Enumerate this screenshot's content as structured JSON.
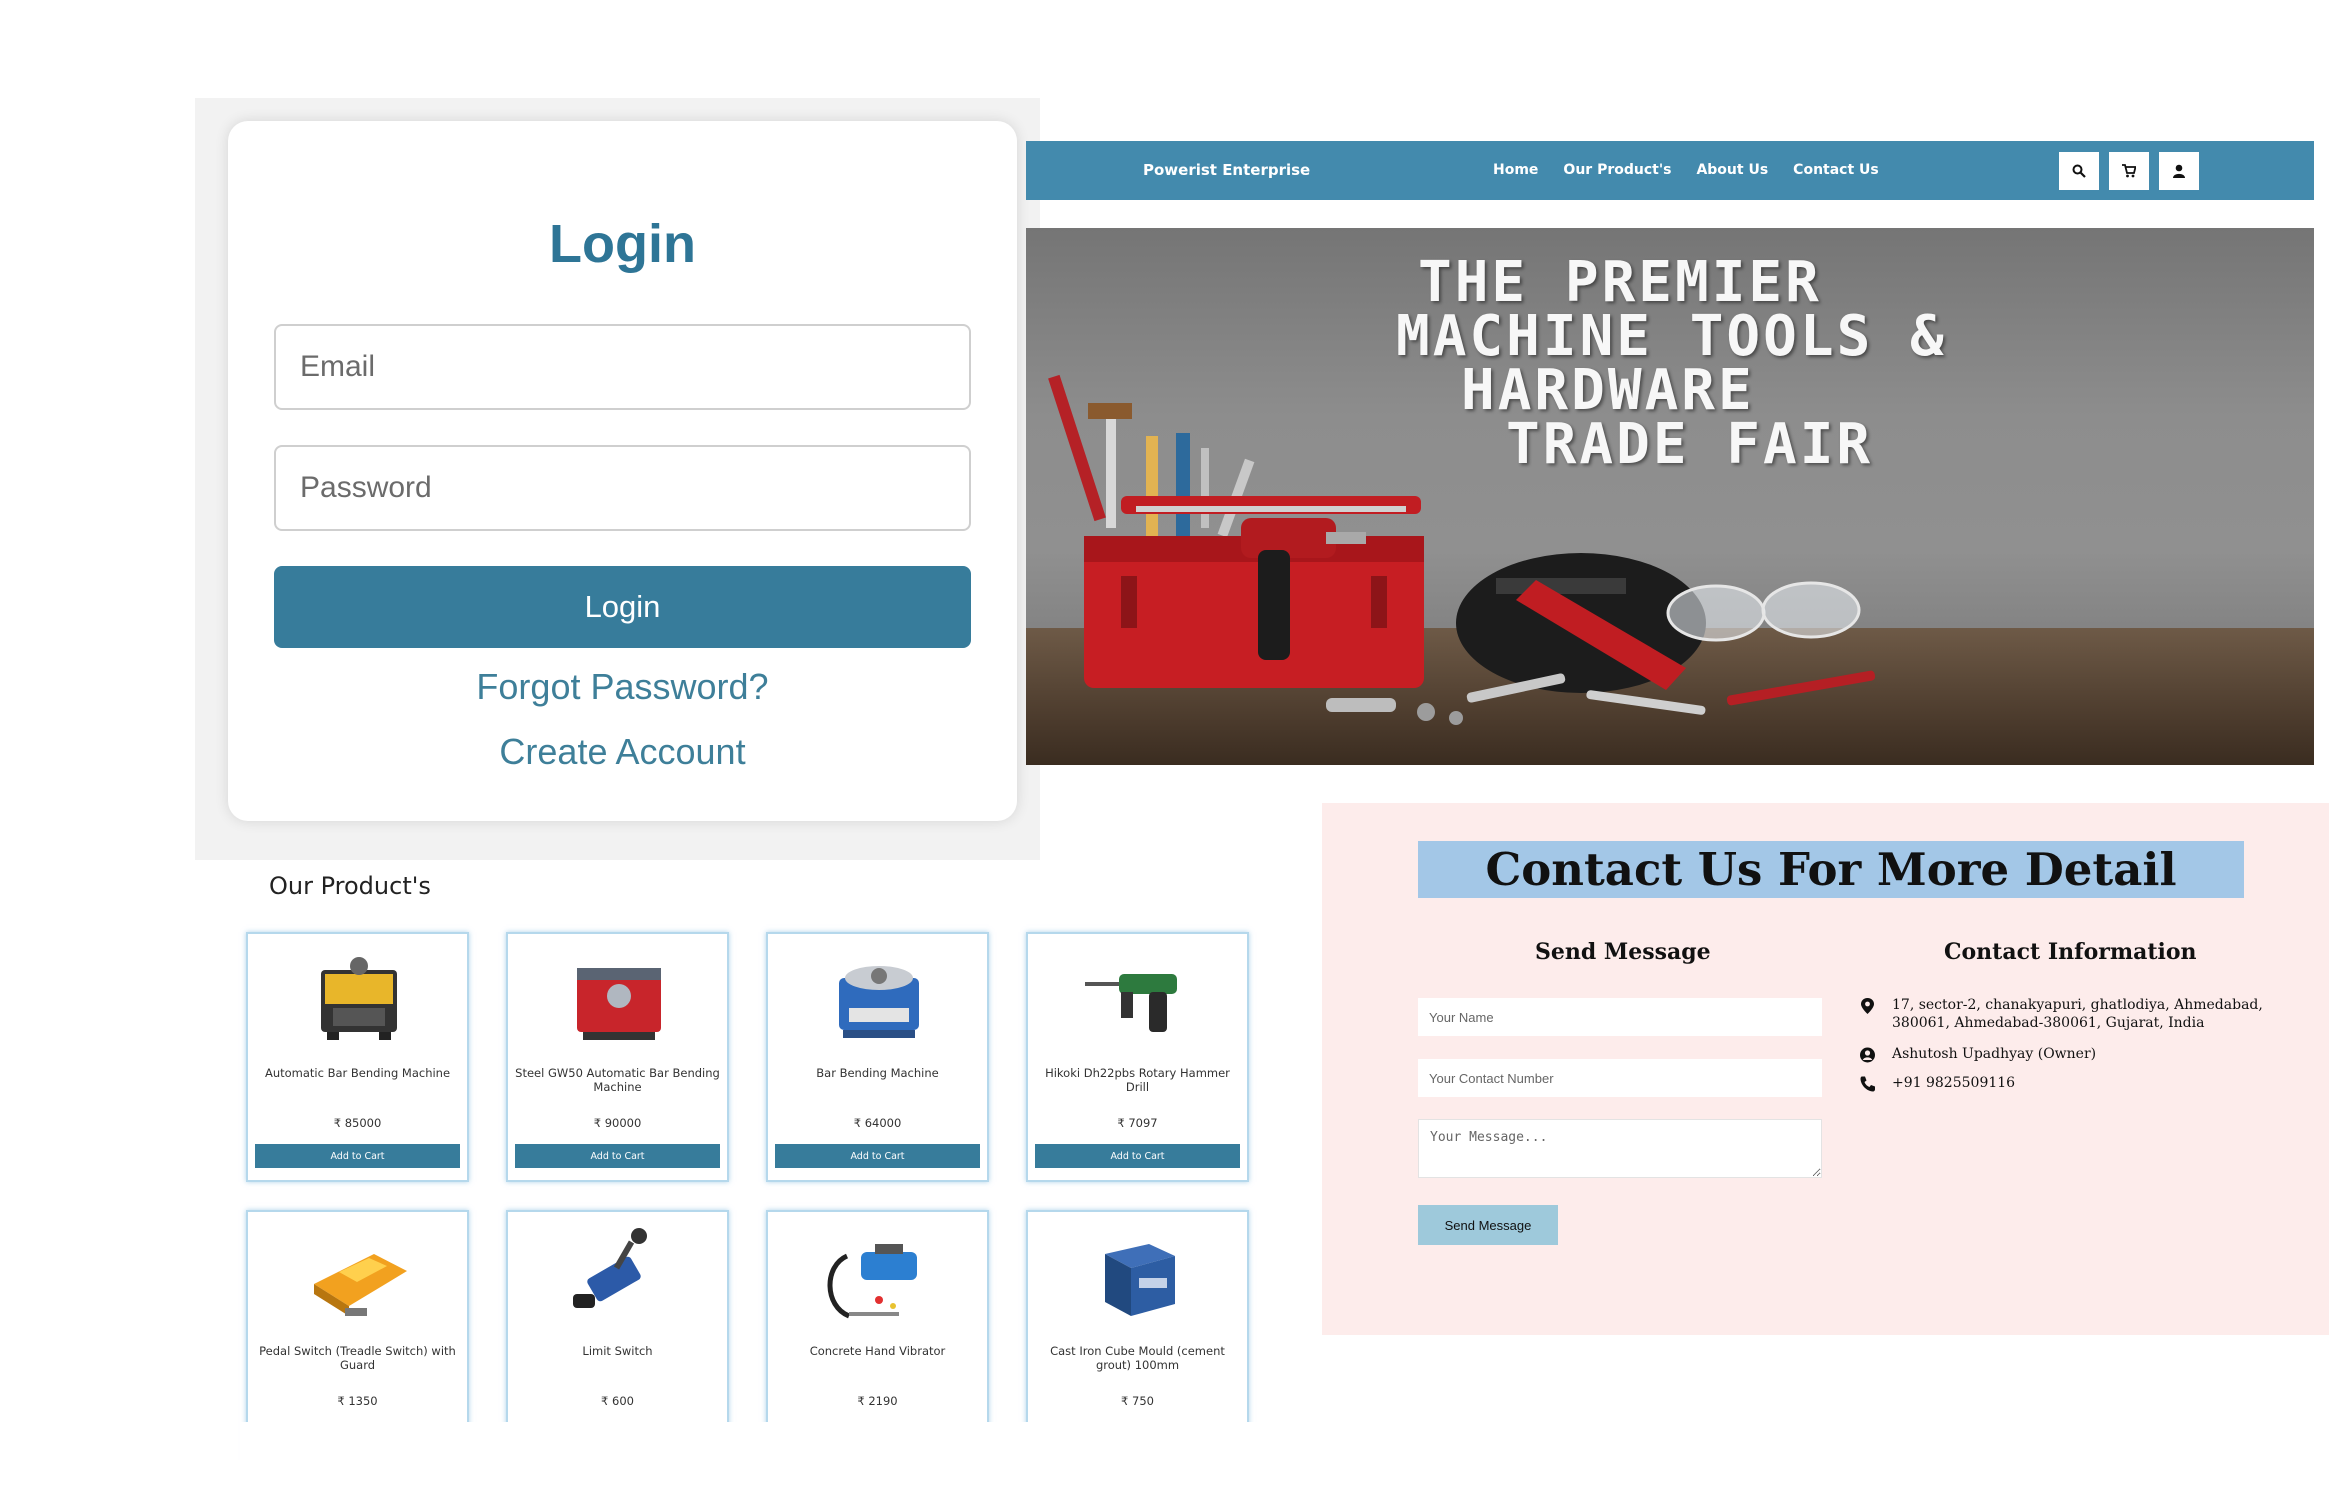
{
  "login": {
    "title": "Login",
    "email_placeholder": "Email",
    "password_placeholder": "Password",
    "button_label": "Login",
    "forgot_label": "Forgot Password?",
    "create_label": "Create Account"
  },
  "header": {
    "brand": "Powerist Enterprise",
    "nav": [
      "Home",
      "Our Product's",
      "About Us",
      "Contact Us"
    ],
    "icons": [
      "search-icon",
      "cart-icon",
      "user-icon"
    ]
  },
  "hero": {
    "headline": [
      "THE PREMIER",
      "MACHINE TOOLS &",
      "HARDWARE",
      "TRADE FAIR"
    ]
  },
  "products": {
    "heading": "Our Product's",
    "add_to_cart_label": "Add to Cart",
    "items": [
      {
        "name": "Automatic Bar Bending Machine",
        "price": "₹ 85000",
        "icon": "bar-bending-machine-icon"
      },
      {
        "name": "Steel GW50 Automatic Bar Bending Machine",
        "price": "₹ 90000",
        "icon": "steel-bending-machine-icon"
      },
      {
        "name": "Bar Bending Machine",
        "price": "₹ 64000",
        "icon": "bending-machine-icon"
      },
      {
        "name": "Hikoki Dh22pbs Rotary Hammer Drill",
        "price": "₹ 7097",
        "icon": "rotary-hammer-drill-icon"
      },
      {
        "name": "Pedal Switch (Treadle Switch) with Guard",
        "price": "₹ 1350",
        "icon": "pedal-switch-icon"
      },
      {
        "name": "Limit Switch",
        "price": "₹ 600",
        "icon": "limit-switch-icon"
      },
      {
        "name": "Concrete Hand Vibrator",
        "price": "₹ 2190",
        "icon": "concrete-vibrator-icon"
      },
      {
        "name": "Cast Iron Cube Mould (cement grout) 100mm",
        "price": "₹ 750",
        "icon": "cube-mould-icon"
      }
    ]
  },
  "contact": {
    "title": "Contact Us For More Detail",
    "send_message_heading": "Send Message",
    "contact_info_heading": "Contact Information",
    "name_placeholder": "Your Name",
    "phone_placeholder": "Your Contact Number",
    "message_placeholder": "Your Message...",
    "send_button_label": "Send Message",
    "address": "17, sector-2, chanakyapuri, ghatlodiya, Ahmedabad, 380061, Ahmedabad-380061, Gujarat, India",
    "owner": "Ashutosh Upadhyay (Owner)",
    "phone": "+91 9825509116"
  },
  "colors": {
    "accent": "#377c9b",
    "header_bg": "#438aad",
    "contact_bg": "#fdeceb",
    "contact_title_bg": "#a3c7e7",
    "send_button_bg": "#9ec9db"
  }
}
